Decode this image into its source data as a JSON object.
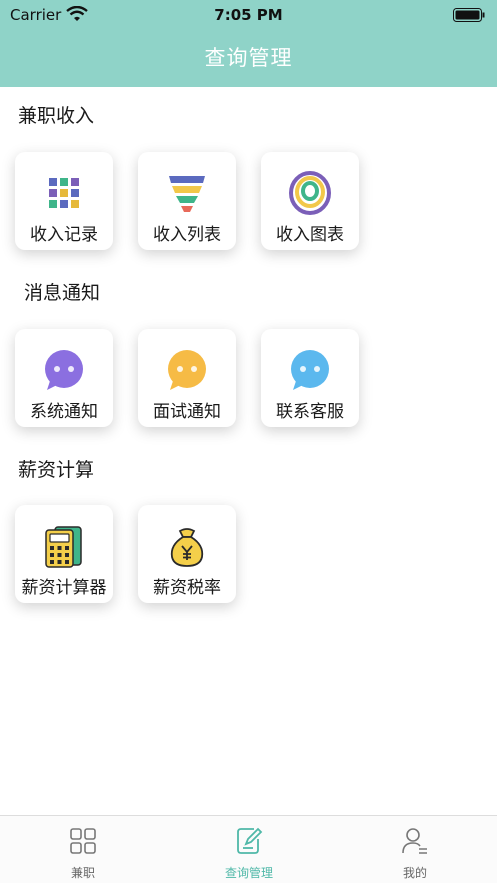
{
  "status": {
    "carrier": "Carrier",
    "time": "7:05 PM"
  },
  "header": {
    "title": "查询管理"
  },
  "sections": [
    {
      "title": "兼职收入",
      "items": [
        {
          "label": "收入记录",
          "icon": "grid-icon"
        },
        {
          "label": "收入列表",
          "icon": "funnel-list-icon"
        },
        {
          "label": "收入图表",
          "icon": "rings-chart-icon"
        }
      ]
    },
    {
      "title": "消息通知",
      "items": [
        {
          "label": "系统通知",
          "icon": "purple-chat-icon"
        },
        {
          "label": "面试通知",
          "icon": "yellow-chat-icon"
        },
        {
          "label": "联系客服",
          "icon": "blue-chat-icon"
        }
      ]
    },
    {
      "title": "薪资计算",
      "items": [
        {
          "label": "薪资计算器",
          "icon": "calculator-icon"
        },
        {
          "label": "薪资税率",
          "icon": "money-bag-icon"
        }
      ]
    }
  ],
  "tabbar": {
    "items": [
      {
        "label": "兼职",
        "icon": "grid-outline-icon",
        "active": false
      },
      {
        "label": "查询管理",
        "icon": "edit-doc-icon",
        "active": true
      },
      {
        "label": "我的",
        "icon": "person-icon",
        "active": false
      }
    ]
  },
  "colors": {
    "header": "#8fd3c8",
    "accent": "#4fb8a8"
  }
}
